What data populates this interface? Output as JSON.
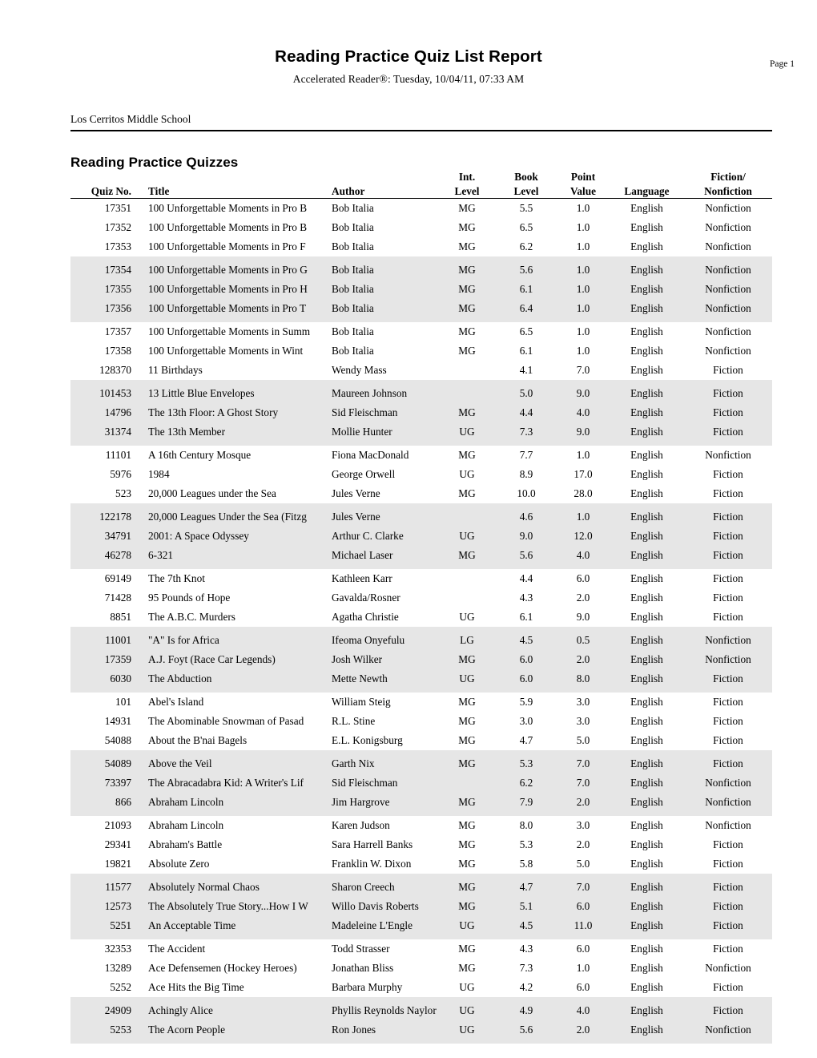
{
  "header": {
    "title": "Reading Practice Quiz List Report",
    "subtitle": "Accelerated Reader®:  Tuesday, 10/04/11, 07:33 AM",
    "page_label": "Page 1"
  },
  "school": {
    "name": "Los Cerritos Middle School"
  },
  "section": {
    "heading": "Reading Practice Quizzes"
  },
  "table": {
    "columns": [
      {
        "key": "quiz_no",
        "line1": "",
        "line2": "Quiz No.",
        "align": "right"
      },
      {
        "key": "title",
        "line1": "",
        "line2": "Title",
        "align": "left"
      },
      {
        "key": "author",
        "line1": "",
        "line2": "Author",
        "align": "left"
      },
      {
        "key": "int_level",
        "line1": "Int.",
        "line2": "Level",
        "align": "center"
      },
      {
        "key": "book_level",
        "line1": "Book",
        "line2": "Level",
        "align": "center"
      },
      {
        "key": "points",
        "line1": "Point",
        "line2": "Value",
        "align": "center"
      },
      {
        "key": "language",
        "line1": "",
        "line2": "Language",
        "align": "center"
      },
      {
        "key": "fiction",
        "line1": "Fiction/",
        "line2": "Nonfiction",
        "align": "center"
      }
    ],
    "rows": [
      {
        "quiz_no": "17351",
        "title": "100 Unforgettable Moments in Pro B",
        "author": "Bob Italia",
        "int_level": "MG",
        "book_level": "5.5",
        "points": "1.0",
        "language": "English",
        "fiction": "Nonfiction"
      },
      {
        "quiz_no": "17352",
        "title": "100 Unforgettable Moments in Pro B",
        "author": "Bob Italia",
        "int_level": "MG",
        "book_level": "6.5",
        "points": "1.0",
        "language": "English",
        "fiction": "Nonfiction"
      },
      {
        "quiz_no": "17353",
        "title": "100 Unforgettable Moments in Pro F",
        "author": "Bob Italia",
        "int_level": "MG",
        "book_level": "6.2",
        "points": "1.0",
        "language": "English",
        "fiction": "Nonfiction"
      },
      {
        "quiz_no": "17354",
        "title": "100 Unforgettable Moments in Pro G",
        "author": "Bob Italia",
        "int_level": "MG",
        "book_level": "5.6",
        "points": "1.0",
        "language": "English",
        "fiction": "Nonfiction"
      },
      {
        "quiz_no": "17355",
        "title": "100 Unforgettable Moments in Pro H",
        "author": "Bob Italia",
        "int_level": "MG",
        "book_level": "6.1",
        "points": "1.0",
        "language": "English",
        "fiction": "Nonfiction"
      },
      {
        "quiz_no": "17356",
        "title": "100 Unforgettable Moments in Pro T",
        "author": "Bob Italia",
        "int_level": "MG",
        "book_level": "6.4",
        "points": "1.0",
        "language": "English",
        "fiction": "Nonfiction"
      },
      {
        "quiz_no": "17357",
        "title": "100 Unforgettable Moments in Summ",
        "author": "Bob Italia",
        "int_level": "MG",
        "book_level": "6.5",
        "points": "1.0",
        "language": "English",
        "fiction": "Nonfiction"
      },
      {
        "quiz_no": "17358",
        "title": "100 Unforgettable Moments in Wint",
        "author": "Bob Italia",
        "int_level": "MG",
        "book_level": "6.1",
        "points": "1.0",
        "language": "English",
        "fiction": "Nonfiction"
      },
      {
        "quiz_no": "128370",
        "title": "11 Birthdays",
        "author": "Wendy Mass",
        "int_level": "",
        "book_level": "4.1",
        "points": "7.0",
        "language": "English",
        "fiction": "Fiction"
      },
      {
        "quiz_no": "101453",
        "title": "13 Little Blue Envelopes",
        "author": "Maureen Johnson",
        "int_level": "",
        "book_level": "5.0",
        "points": "9.0",
        "language": "English",
        "fiction": "Fiction"
      },
      {
        "quiz_no": "14796",
        "title": "The 13th Floor: A Ghost Story",
        "author": "Sid Fleischman",
        "int_level": "MG",
        "book_level": "4.4",
        "points": "4.0",
        "language": "English",
        "fiction": "Fiction"
      },
      {
        "quiz_no": "31374",
        "title": "The 13th Member",
        "author": "Mollie Hunter",
        "int_level": "UG",
        "book_level": "7.3",
        "points": "9.0",
        "language": "English",
        "fiction": "Fiction"
      },
      {
        "quiz_no": "11101",
        "title": "A 16th Century Mosque",
        "author": "Fiona MacDonald",
        "int_level": "MG",
        "book_level": "7.7",
        "points": "1.0",
        "language": "English",
        "fiction": "Nonfiction"
      },
      {
        "quiz_no": "5976",
        "title": "1984",
        "author": "George Orwell",
        "int_level": "UG",
        "book_level": "8.9",
        "points": "17.0",
        "language": "English",
        "fiction": "Fiction"
      },
      {
        "quiz_no": "523",
        "title": "20,000 Leagues under the Sea",
        "author": "Jules Verne",
        "int_level": "MG",
        "book_level": "10.0",
        "points": "28.0",
        "language": "English",
        "fiction": "Fiction"
      },
      {
        "quiz_no": "122178",
        "title": "20,000 Leagues Under the Sea (Fitzg",
        "author": "Jules Verne",
        "int_level": "",
        "book_level": "4.6",
        "points": "1.0",
        "language": "English",
        "fiction": "Fiction"
      },
      {
        "quiz_no": "34791",
        "title": "2001: A Space Odyssey",
        "author": "Arthur C. Clarke",
        "int_level": "UG",
        "book_level": "9.0",
        "points": "12.0",
        "language": "English",
        "fiction": "Fiction"
      },
      {
        "quiz_no": "46278",
        "title": "6-321",
        "author": "Michael Laser",
        "int_level": "MG",
        "book_level": "5.6",
        "points": "4.0",
        "language": "English",
        "fiction": "Fiction"
      },
      {
        "quiz_no": "69149",
        "title": "The 7th Knot",
        "author": "Kathleen Karr",
        "int_level": "",
        "book_level": "4.4",
        "points": "6.0",
        "language": "English",
        "fiction": "Fiction"
      },
      {
        "quiz_no": "71428",
        "title": "95 Pounds of Hope",
        "author": "Gavalda/Rosner",
        "int_level": "",
        "book_level": "4.3",
        "points": "2.0",
        "language": "English",
        "fiction": "Fiction"
      },
      {
        "quiz_no": "8851",
        "title": "The A.B.C. Murders",
        "author": "Agatha Christie",
        "int_level": "UG",
        "book_level": "6.1",
        "points": "9.0",
        "language": "English",
        "fiction": "Fiction"
      },
      {
        "quiz_no": "11001",
        "title": "\"A\" Is for Africa",
        "author": "Ifeoma Onyefulu",
        "int_level": "LG",
        "book_level": "4.5",
        "points": "0.5",
        "language": "English",
        "fiction": "Nonfiction"
      },
      {
        "quiz_no": "17359",
        "title": "A.J. Foyt (Race Car Legends)",
        "author": "Josh Wilker",
        "int_level": "MG",
        "book_level": "6.0",
        "points": "2.0",
        "language": "English",
        "fiction": "Nonfiction"
      },
      {
        "quiz_no": "6030",
        "title": "The Abduction",
        "author": "Mette Newth",
        "int_level": "UG",
        "book_level": "6.0",
        "points": "8.0",
        "language": "English",
        "fiction": "Fiction"
      },
      {
        "quiz_no": "101",
        "title": "Abel's Island",
        "author": "William Steig",
        "int_level": "MG",
        "book_level": "5.9",
        "points": "3.0",
        "language": "English",
        "fiction": "Fiction"
      },
      {
        "quiz_no": "14931",
        "title": "The Abominable Snowman of Pasad",
        "author": "R.L. Stine",
        "int_level": "MG",
        "book_level": "3.0",
        "points": "3.0",
        "language": "English",
        "fiction": "Fiction"
      },
      {
        "quiz_no": "54088",
        "title": "About the B'nai Bagels",
        "author": "E.L. Konigsburg",
        "int_level": "MG",
        "book_level": "4.7",
        "points": "5.0",
        "language": "English",
        "fiction": "Fiction"
      },
      {
        "quiz_no": "54089",
        "title": "Above the Veil",
        "author": "Garth Nix",
        "int_level": "MG",
        "book_level": "5.3",
        "points": "7.0",
        "language": "English",
        "fiction": "Fiction"
      },
      {
        "quiz_no": "73397",
        "title": "The Abracadabra Kid: A Writer's Lif",
        "author": "Sid Fleischman",
        "int_level": "",
        "book_level": "6.2",
        "points": "7.0",
        "language": "English",
        "fiction": "Nonfiction"
      },
      {
        "quiz_no": "866",
        "title": "Abraham Lincoln",
        "author": "Jim Hargrove",
        "int_level": "MG",
        "book_level": "7.9",
        "points": "2.0",
        "language": "English",
        "fiction": "Nonfiction"
      },
      {
        "quiz_no": "21093",
        "title": "Abraham Lincoln",
        "author": "Karen Judson",
        "int_level": "MG",
        "book_level": "8.0",
        "points": "3.0",
        "language": "English",
        "fiction": "Nonfiction"
      },
      {
        "quiz_no": "29341",
        "title": "Abraham's Battle",
        "author": "Sara Harrell Banks",
        "int_level": "MG",
        "book_level": "5.3",
        "points": "2.0",
        "language": "English",
        "fiction": "Fiction"
      },
      {
        "quiz_no": "19821",
        "title": "Absolute Zero",
        "author": "Franklin W. Dixon",
        "int_level": "MG",
        "book_level": "5.8",
        "points": "5.0",
        "language": "English",
        "fiction": "Fiction"
      },
      {
        "quiz_no": "11577",
        "title": "Absolutely Normal Chaos",
        "author": "Sharon Creech",
        "int_level": "MG",
        "book_level": "4.7",
        "points": "7.0",
        "language": "English",
        "fiction": "Fiction"
      },
      {
        "quiz_no": "12573",
        "title": "The Absolutely True Story...How I W",
        "author": "Willo Davis Roberts",
        "int_level": "MG",
        "book_level": "5.1",
        "points": "6.0",
        "language": "English",
        "fiction": "Fiction"
      },
      {
        "quiz_no": "5251",
        "title": "An Acceptable Time",
        "author": "Madeleine L'Engle",
        "int_level": "UG",
        "book_level": "4.5",
        "points": "11.0",
        "language": "English",
        "fiction": "Fiction"
      },
      {
        "quiz_no": "32353",
        "title": "The Accident",
        "author": "Todd Strasser",
        "int_level": "MG",
        "book_level": "4.3",
        "points": "6.0",
        "language": "English",
        "fiction": "Fiction"
      },
      {
        "quiz_no": "13289",
        "title": "Ace Defensemen (Hockey Heroes)",
        "author": "Jonathan Bliss",
        "int_level": "MG",
        "book_level": "7.3",
        "points": "1.0",
        "language": "English",
        "fiction": "Nonfiction"
      },
      {
        "quiz_no": "5252",
        "title": "Ace Hits the Big Time",
        "author": "Barbara Murphy",
        "int_level": "UG",
        "book_level": "4.2",
        "points": "6.0",
        "language": "English",
        "fiction": "Fiction"
      },
      {
        "quiz_no": "24909",
        "title": "Achingly Alice",
        "author": "Phyllis Reynolds Naylor",
        "int_level": "UG",
        "book_level": "4.9",
        "points": "4.0",
        "language": "English",
        "fiction": "Fiction"
      },
      {
        "quiz_no": "5253",
        "title": "The Acorn People",
        "author": "Ron Jones",
        "int_level": "UG",
        "book_level": "5.6",
        "points": "2.0",
        "language": "English",
        "fiction": "Nonfiction"
      }
    ],
    "shading": {
      "color": "#e6e6e6",
      "group_size": 3,
      "first_shaded_index": 3
    }
  }
}
